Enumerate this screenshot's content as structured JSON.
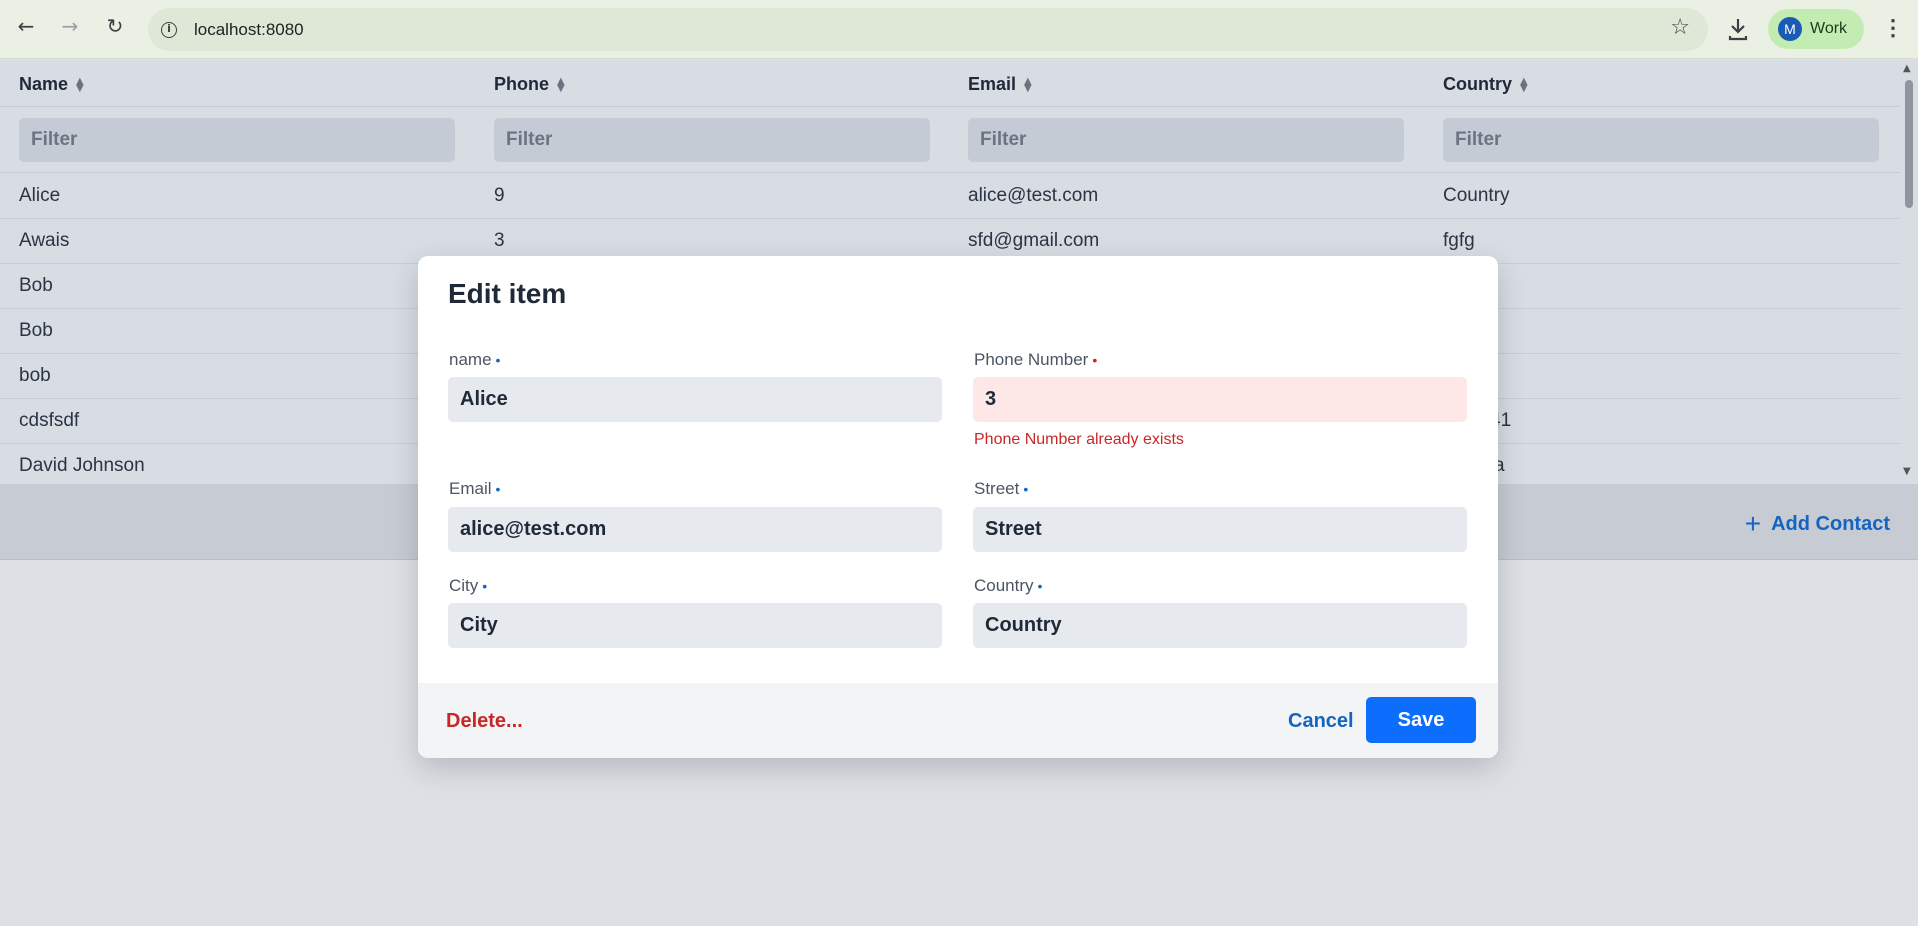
{
  "browser": {
    "url": "localhost:8080",
    "profile_initial": "M",
    "profile_label": "Work",
    "icons": [
      "back-icon",
      "forward-icon",
      "reload-icon",
      "site-info-icon",
      "star-icon",
      "download-icon",
      "kebab-menu-icon"
    ]
  },
  "grid": {
    "columns": [
      "Name",
      "Phone",
      "Email",
      "Country"
    ],
    "filter_placeholder": "Filter",
    "rows": [
      [
        "Alice",
        "9",
        "alice@test.com",
        "Country"
      ],
      [
        "Awais",
        "3",
        "sfd@gmail.com",
        "fgfg"
      ],
      [
        "Bob",
        "",
        "",
        ""
      ],
      [
        "Bob",
        "",
        "",
        ""
      ],
      [
        "bob",
        "",
        "",
        ""
      ],
      [
        "cdsfsdf",
        "",
        "",
        "41"
      ],
      [
        "David Johnson",
        "",
        "",
        "a"
      ]
    ]
  },
  "toolbar": {
    "add_contact_label": "Add Contact",
    "add_icon": "plus-icon"
  },
  "dialog": {
    "title": "Edit item",
    "fields": {
      "name": {
        "label": "name",
        "value": "Alice"
      },
      "phone": {
        "label": "Phone Number",
        "value": "3",
        "error": "Phone Number already exists"
      },
      "email": {
        "label": "Email",
        "value": "alice@test.com"
      },
      "street": {
        "label": "Street",
        "value": "Street"
      },
      "city": {
        "label": "City",
        "value": "City"
      },
      "country": {
        "label": "Country",
        "value": "Country"
      }
    },
    "required_indicator": "•",
    "delete_label": "Delete...",
    "cancel_label": "Cancel",
    "save_label": "Save"
  },
  "colors": {
    "accent": "#0d6efd",
    "link": "#1565c0",
    "error": "#c62828",
    "error_bg": "#fde7e7"
  }
}
